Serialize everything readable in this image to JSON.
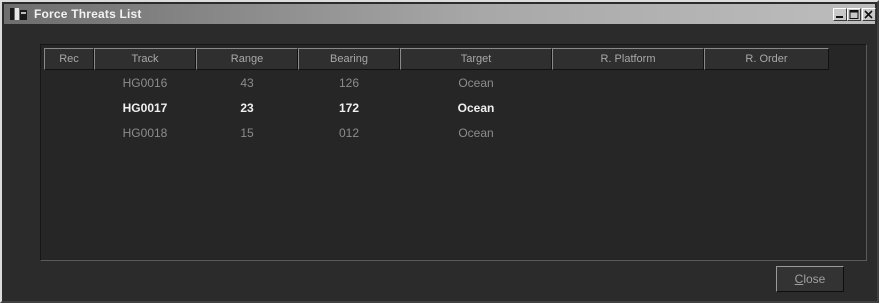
{
  "window": {
    "title": "Force Threats List",
    "icon": "app-icon"
  },
  "title_buttons": {
    "minimize": "minimize-icon",
    "maximize": "maximize-icon",
    "close": "close-icon"
  },
  "table": {
    "columns": [
      "Rec",
      "Track",
      "Range",
      "Bearing",
      "Target",
      "R. Platform",
      "R. Order"
    ],
    "rows": [
      {
        "rec": "",
        "track": "HG0016",
        "range": "43",
        "bearing": "126",
        "target": "Ocean",
        "platform": "",
        "order": "",
        "style": "dim"
      },
      {
        "rec": "",
        "track": "HG0017",
        "range": "23",
        "bearing": "172",
        "target": "Ocean",
        "platform": "",
        "order": "",
        "style": "bright"
      },
      {
        "rec": "",
        "track": "HG0018",
        "range": "15",
        "bearing": "012",
        "target": "Ocean",
        "platform": "",
        "order": "",
        "style": "dim"
      }
    ]
  },
  "footer": {
    "close_label": "Close",
    "close_accel": "C",
    "close_rest": "lose"
  },
  "colors": {
    "window_bg": "#2b2b2b",
    "title_gradient_start": "#6e6e6e",
    "row_dim": "#8c8c8c",
    "row_bright": "#f0f0f0"
  }
}
